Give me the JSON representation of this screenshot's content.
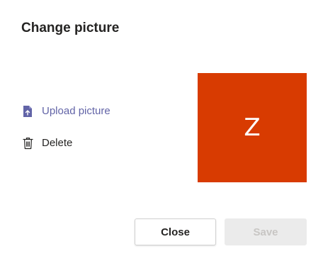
{
  "dialog": {
    "title": "Change picture",
    "actions": {
      "upload_label": "Upload picture",
      "delete_label": "Delete"
    },
    "avatar": {
      "initial": "Z",
      "background_color": "#d83b01"
    },
    "buttons": {
      "close_label": "Close",
      "save_label": "Save",
      "save_disabled": true
    }
  },
  "icons": {
    "upload": "upload-file-icon",
    "delete": "trash-icon"
  },
  "colors": {
    "accent": "#6264a7",
    "text": "#252423",
    "disabled_text": "#c8c6c4",
    "disabled_bg": "#ebebeb"
  }
}
